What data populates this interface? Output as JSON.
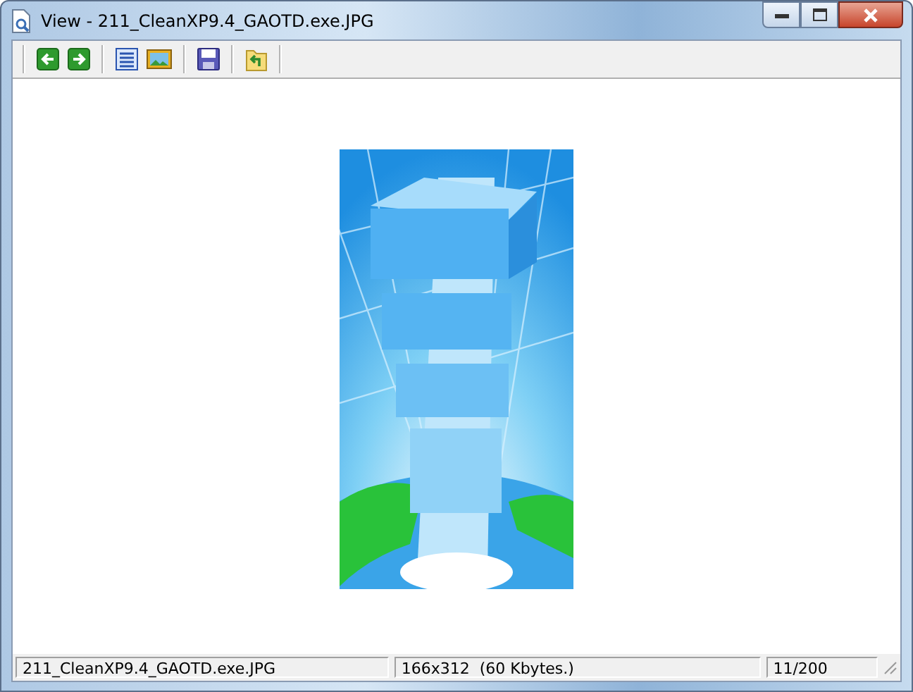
{
  "window": {
    "title": "View - 211_CleanXP9.4_GAOTD.exe.JPG"
  },
  "status_bar": [
    "211_CleanXP9.4_GAOTD.exe.JPG",
    "166x312  (60 Kbytes.)",
    "11/200"
  ]
}
